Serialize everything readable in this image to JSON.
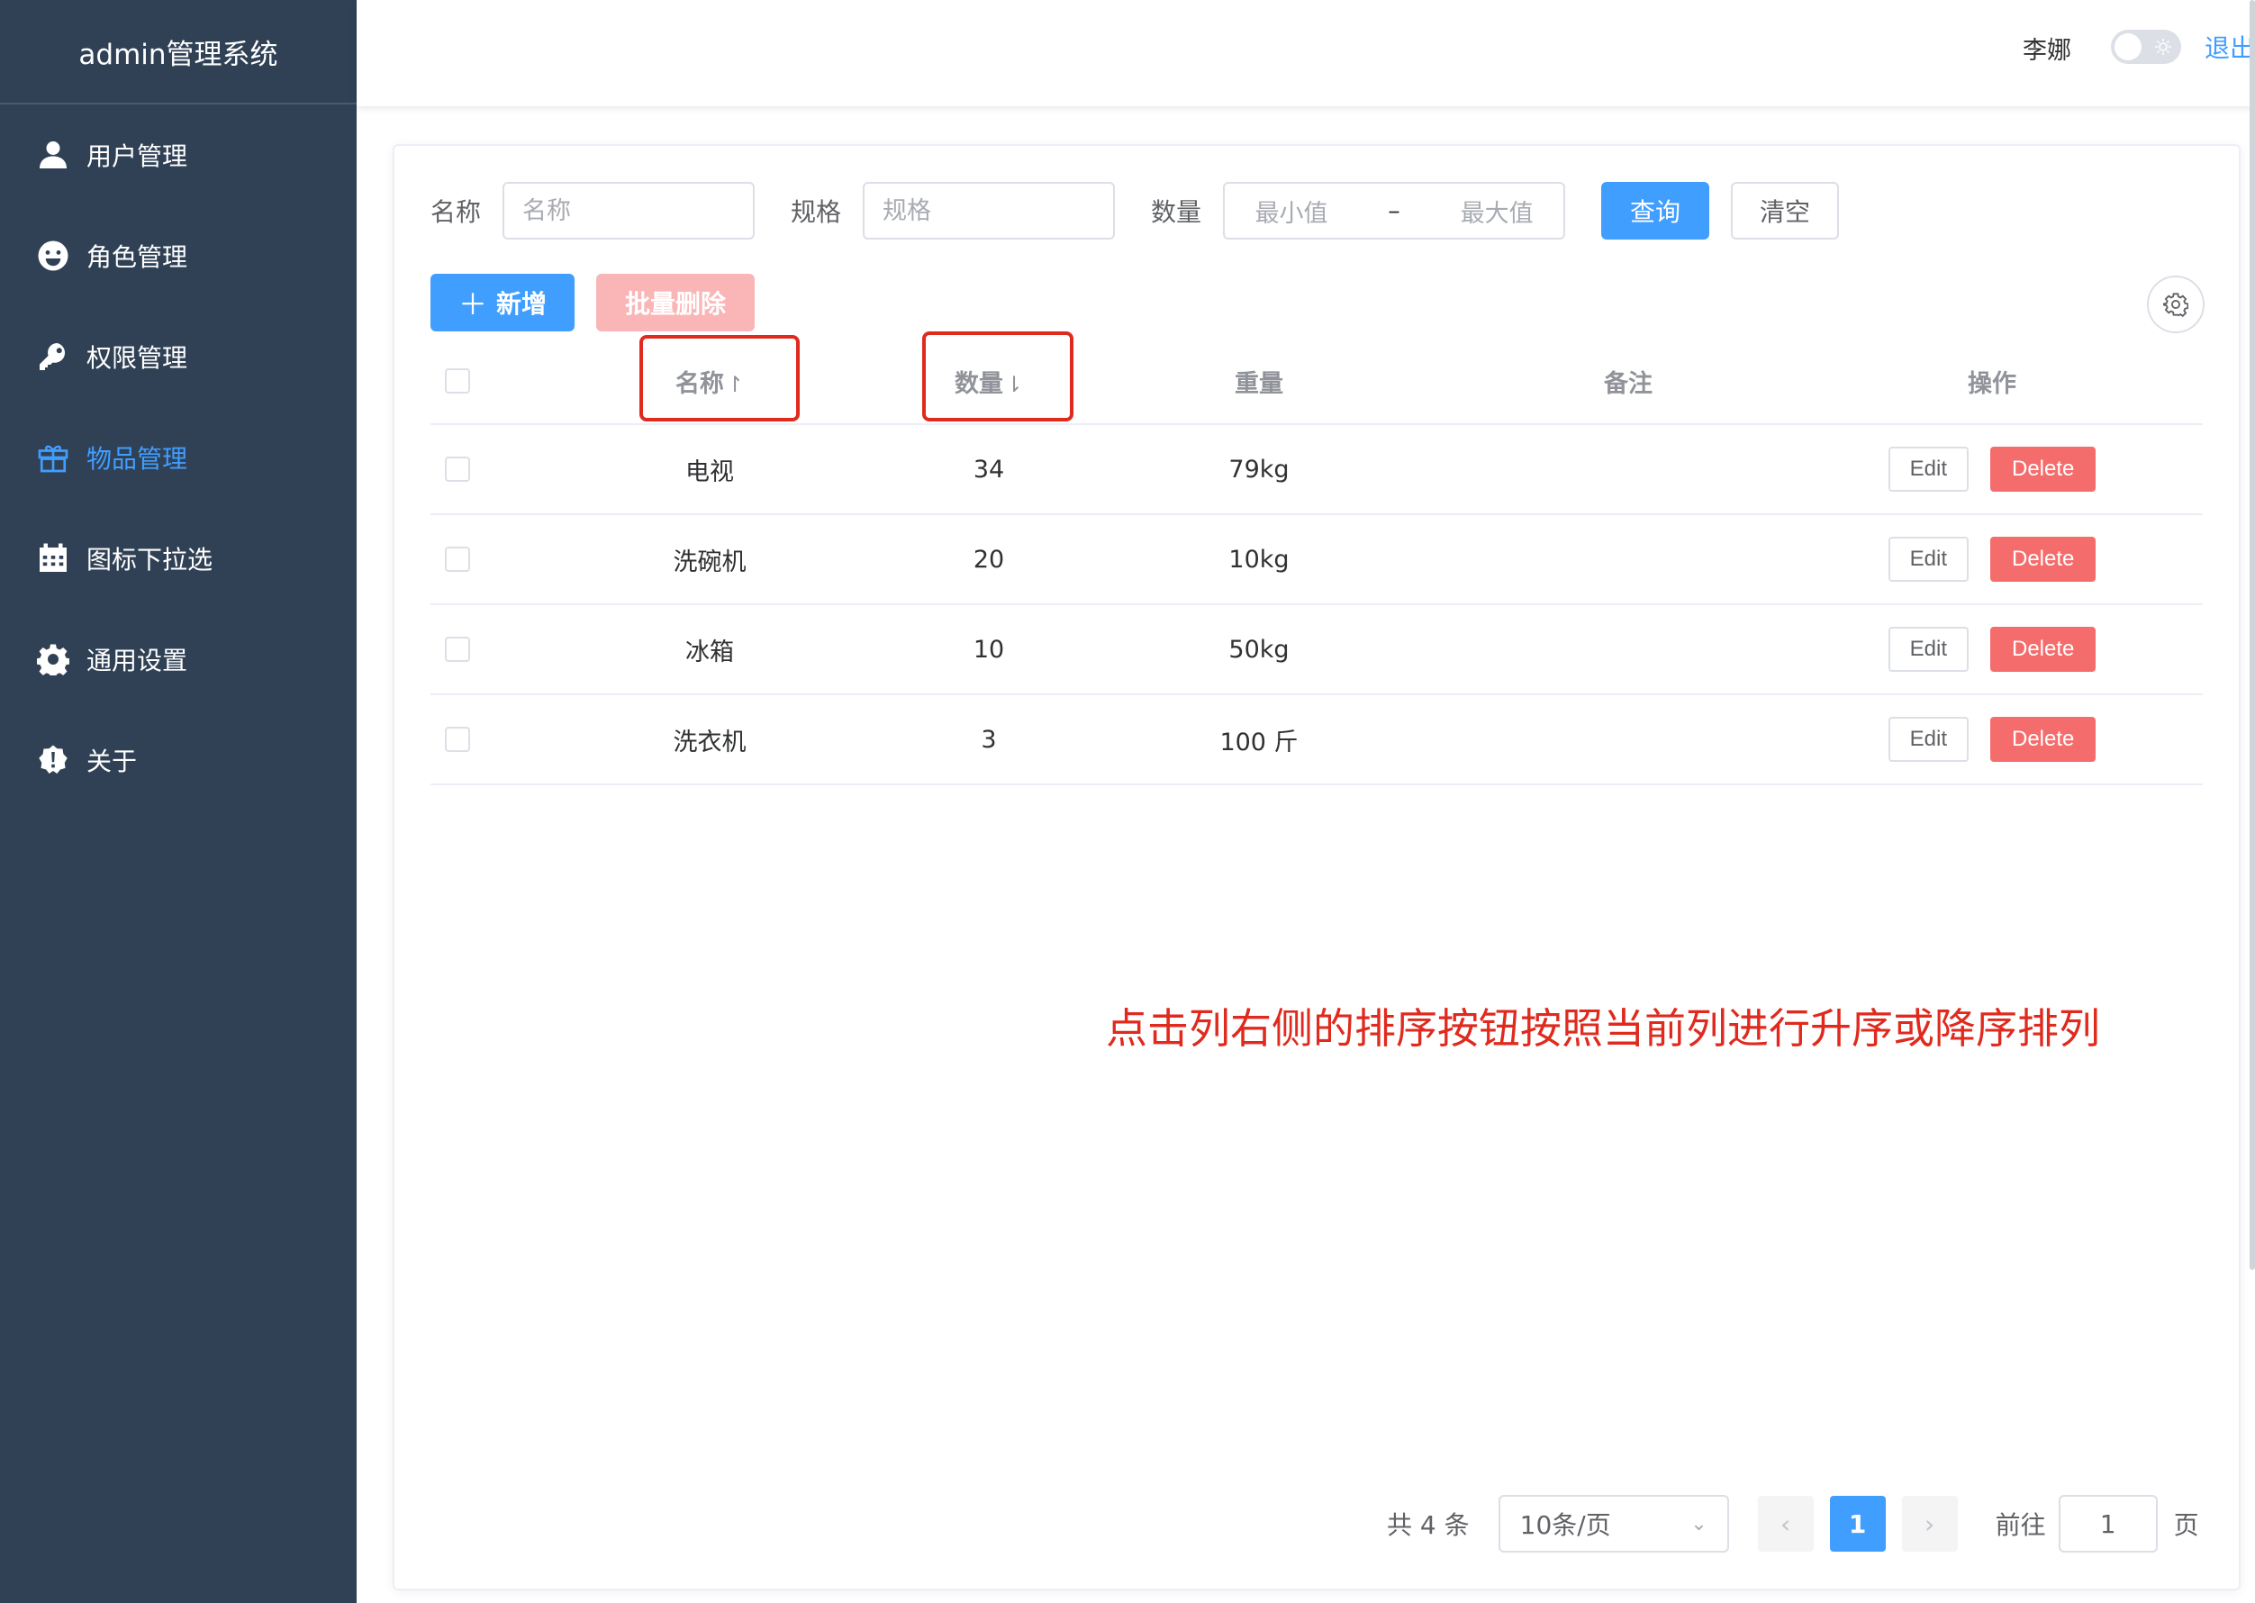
{
  "brand": "admin管理系统",
  "menu": [
    {
      "label": "用户管理",
      "icon": "user-icon"
    },
    {
      "label": "角色管理",
      "icon": "smile-icon"
    },
    {
      "label": "权限管理",
      "icon": "key-icon"
    },
    {
      "label": "物品管理",
      "icon": "gift-icon",
      "active": true
    },
    {
      "label": "图标下拉选",
      "icon": "calendar-icon"
    },
    {
      "label": "通用设置",
      "icon": "gear-icon"
    },
    {
      "label": "关于",
      "icon": "warning-badge-icon"
    }
  ],
  "header": {
    "user": "李娜",
    "logout": "退出"
  },
  "filter": {
    "name_label": "名称",
    "name_placeholder": "名称",
    "spec_label": "规格",
    "spec_placeholder": "规格",
    "qty_label": "数量",
    "min_placeholder": "最小值",
    "range_sep": "–",
    "max_placeholder": "最大值",
    "search": "查询",
    "clear": "清空"
  },
  "actions": {
    "add": "新增",
    "batch_delete": "批量删除"
  },
  "table": {
    "columns": {
      "name": "名称",
      "name_sort": "↾",
      "qty": "数量",
      "qty_sort": "⇂",
      "weight": "重量",
      "remark": "备注",
      "ops": "操作"
    },
    "rows": [
      {
        "name": "电视",
        "qty": "34",
        "weight": "79kg",
        "remark": ""
      },
      {
        "name": "洗碗机",
        "qty": "20",
        "weight": "10kg",
        "remark": ""
      },
      {
        "name": "冰箱",
        "qty": "10",
        "weight": "50kg",
        "remark": ""
      },
      {
        "name": "洗衣机",
        "qty": "3",
        "weight": "100 斤",
        "remark": ""
      }
    ],
    "edit": "Edit",
    "delete": "Delete"
  },
  "annotation": "点击列右侧的排序按钮按照当前列进行升序或降序排列",
  "pagination": {
    "total": "共 4 条",
    "page_size": "10条/页",
    "current": "1",
    "goto_label": "前往",
    "goto_value": "1",
    "page_suffix": "页"
  },
  "colors": {
    "sidebar": "#304156",
    "primary": "#409eff",
    "danger": "#f56c6c",
    "annotation": "#e02a1e"
  }
}
